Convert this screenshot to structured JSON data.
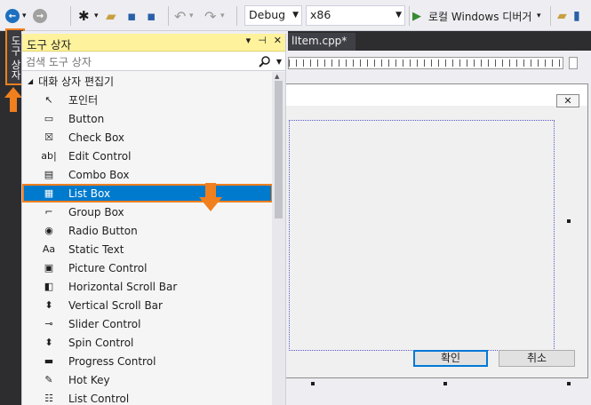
{
  "toolbar": {
    "config_value": "Debug",
    "platform_value": "x86",
    "run_label": "로컬 Windows 디버거"
  },
  "side_tab": {
    "label": "도구 상자"
  },
  "document": {
    "tab_label": "lItem.cpp*",
    "dialog_ok": "확인",
    "dialog_cancel": "취소",
    "dialog_close": "✕"
  },
  "toolbox": {
    "title": "도구 상자",
    "search_placeholder": "검색 도구 상자",
    "category": "대화 상자 편집기",
    "items": [
      {
        "label": "포인터",
        "icon": "pointer-icon",
        "glyph": "↖"
      },
      {
        "label": "Button",
        "icon": "button-icon",
        "glyph": "▭"
      },
      {
        "label": "Check Box",
        "icon": "checkbox-icon",
        "glyph": "☒"
      },
      {
        "label": "Edit Control",
        "icon": "edit-control-icon",
        "glyph": "ab|"
      },
      {
        "label": "Combo Box",
        "icon": "combo-box-icon",
        "glyph": "▤"
      },
      {
        "label": "List Box",
        "icon": "list-box-icon",
        "glyph": "▦"
      },
      {
        "label": "Group Box",
        "icon": "group-box-icon",
        "glyph": "⌐"
      },
      {
        "label": "Radio Button",
        "icon": "radio-button-icon",
        "glyph": "◉"
      },
      {
        "label": "Static Text",
        "icon": "static-text-icon",
        "glyph": "Aa"
      },
      {
        "label": "Picture Control",
        "icon": "picture-control-icon",
        "glyph": "▣"
      },
      {
        "label": "Horizontal Scroll Bar",
        "icon": "hscroll-icon",
        "glyph": "◧"
      },
      {
        "label": "Vertical Scroll Bar",
        "icon": "vscroll-icon",
        "glyph": "⬍"
      },
      {
        "label": "Slider Control",
        "icon": "slider-icon",
        "glyph": "⊸"
      },
      {
        "label": "Spin Control",
        "icon": "spin-icon",
        "glyph": "⬍"
      },
      {
        "label": "Progress Control",
        "icon": "progress-icon",
        "glyph": "▬"
      },
      {
        "label": "Hot Key",
        "icon": "hotkey-icon",
        "glyph": "✎"
      },
      {
        "label": "List Control",
        "icon": "list-control-icon",
        "glyph": "☷"
      }
    ],
    "selected_index": 5
  },
  "colors": {
    "accent": "#007acc",
    "highlight": "#f07f1e",
    "header": "#fff29d"
  }
}
